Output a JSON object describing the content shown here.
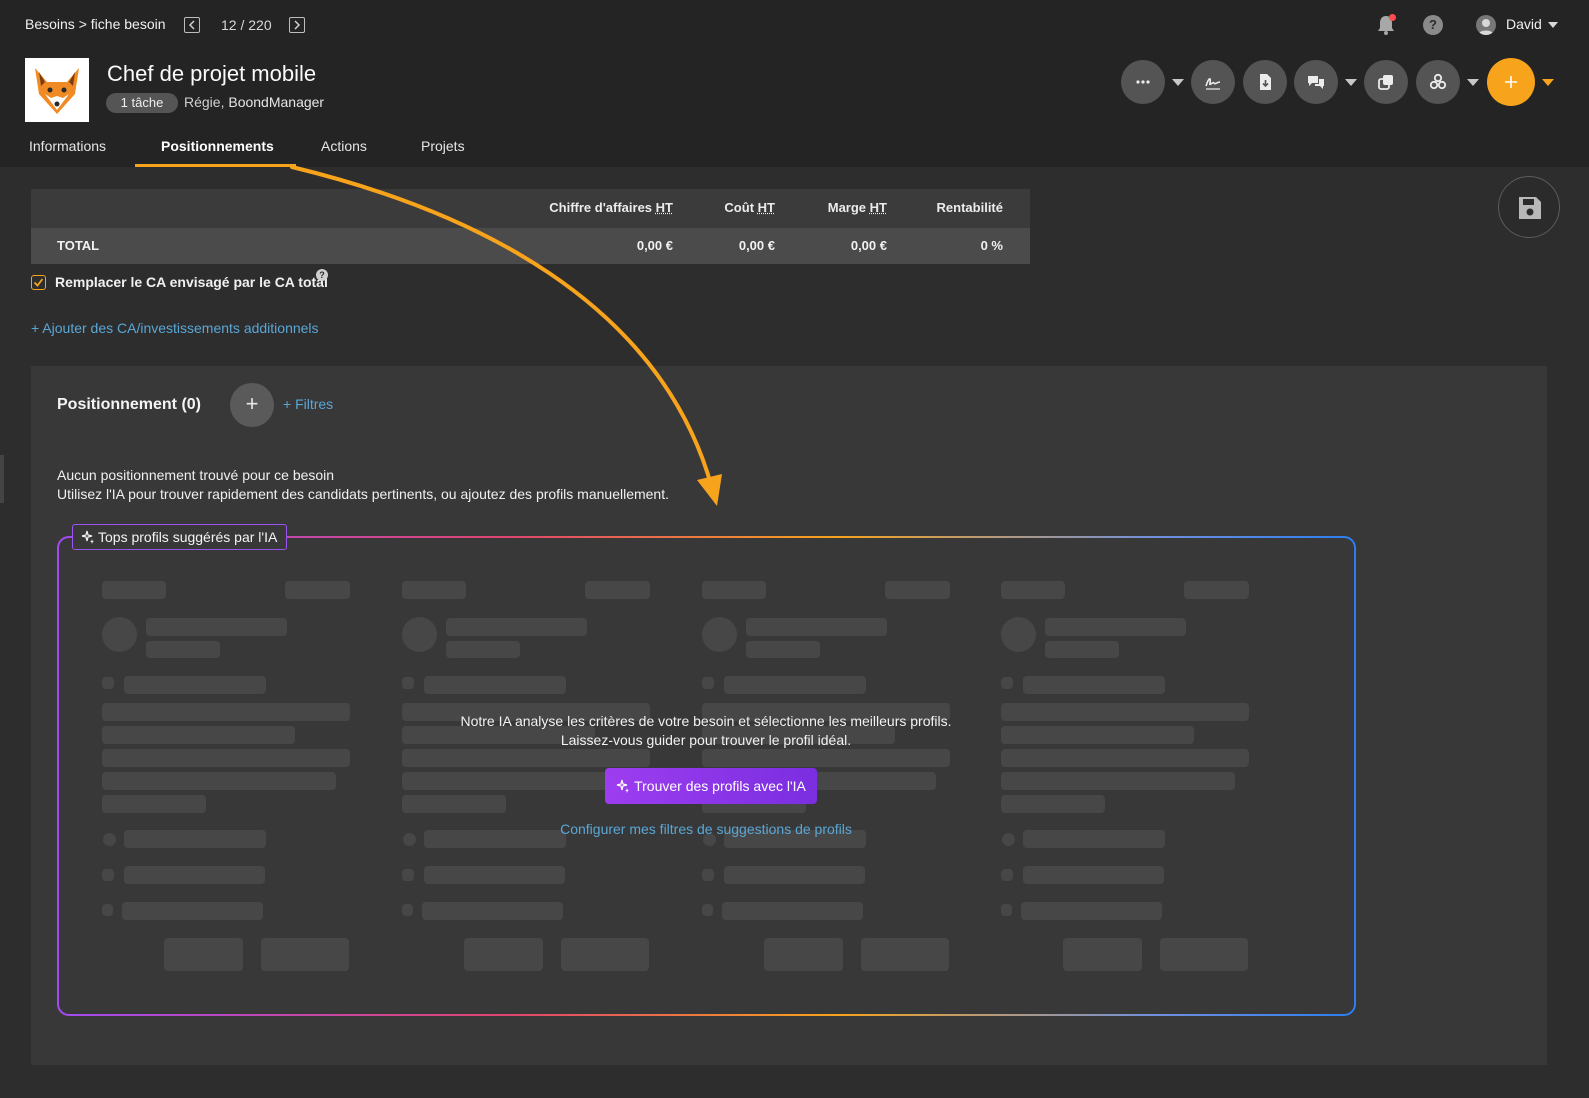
{
  "breadcrumb": {
    "parent": "Besoins",
    "separator": ">",
    "current": "fiche besoin"
  },
  "pager": {
    "text": "12 / 220"
  },
  "record": {
    "title": "Chef de projet mobile",
    "task_badge": "1 tâche",
    "type": "Régie,",
    "company": "BoondManager"
  },
  "topbar": {
    "user_name": "David",
    "help_glyph": "?"
  },
  "toolbar": {
    "buttons": [
      {
        "name": "more-options-button",
        "icon": "ellipsis-icon",
        "glyph": "···"
      },
      {
        "name": "signature-button",
        "icon": "signature-icon"
      },
      {
        "name": "download-document-button",
        "icon": "document-download-icon"
      },
      {
        "name": "comments-button",
        "icon": "chat-bubbles-icon"
      },
      {
        "name": "duplicate-button",
        "icon": "copy-icon"
      },
      {
        "name": "connections-button",
        "icon": "share-network-icon"
      },
      {
        "name": "create-button",
        "icon": "plus-icon",
        "glyph": "+"
      }
    ],
    "accent_color": "#f7a31c"
  },
  "tabs": [
    {
      "label": "Informations",
      "active": false
    },
    {
      "label": "Positionnements",
      "active": true
    },
    {
      "label": "Actions",
      "active": false
    },
    {
      "label": "Projets",
      "active": false
    }
  ],
  "financials": {
    "headers": {
      "revenue": {
        "label": "Chiffre d'affaires",
        "suffix": "HT"
      },
      "cost": {
        "label": "Coût",
        "suffix": "HT"
      },
      "margin": {
        "label": "Marge",
        "suffix": "HT"
      },
      "profitability": {
        "label": "Rentabilité"
      }
    },
    "total_row": {
      "label": "TOTAL",
      "revenue": "0,00 €",
      "cost": "0,00 €",
      "margin": "0,00 €",
      "profitability": "0 %"
    }
  },
  "replace_ca": {
    "label": "Remplacer le CA envisagé par le CA total",
    "checked": true,
    "help_glyph": "?"
  },
  "add_additional": {
    "label": "+ Ajouter des CA/investissements additionnels"
  },
  "positioning": {
    "title": "Positionnement (0)",
    "add_glyph": "+",
    "filters_label": "+ Filtres",
    "empty_line1": "Aucun positionnement trouvé pour ce besoin",
    "empty_line2": "Utilisez l'IA pour trouver rapidement des candidats pertinents, ou ajoutez des profils manuellement."
  },
  "ai": {
    "label": "Tops profils suggérés par l'IA",
    "text_line1": "Notre IA analyse les critères de votre besoin et sélectionne les meilleurs profils.",
    "text_line2": "Laissez-vous guider pour trouver le profil idéal.",
    "button_label": "Trouver des profils avec l'IA",
    "config_link": "Configurer mes filtres de suggestions de profils",
    "colors": {
      "purple": "#9d3df0",
      "orange": "#f7a31c",
      "blue": "#2b7ef0"
    },
    "placeholder_cards": 4
  }
}
